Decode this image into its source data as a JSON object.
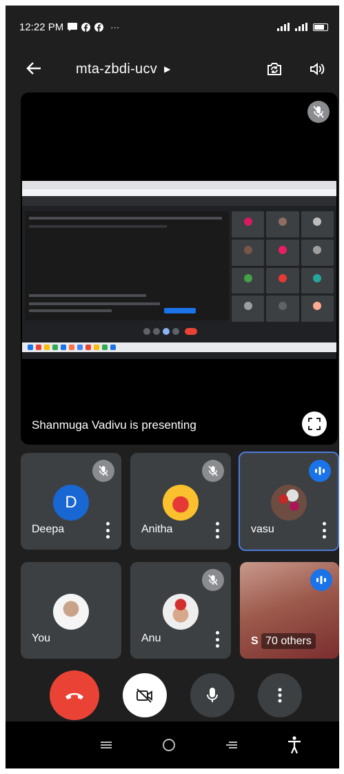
{
  "status_bar": {
    "time": "12:22 PM",
    "notification_icons": [
      "message-icon",
      "facebook-icon",
      "facebook-icon",
      "more-icon"
    ],
    "overflow": "···"
  },
  "app_bar": {
    "meeting_code": "mta-zbdi-ucv",
    "icons": [
      "back-arrow-icon",
      "switch-camera-icon",
      "speaker-icon"
    ]
  },
  "presentation": {
    "label": "Shanmuga Vadivu is presenting"
  },
  "participants": [
    {
      "name": "Deepa",
      "avatar": "D",
      "muted": true,
      "speaking": false
    },
    {
      "name": "Anitha",
      "muted": true,
      "speaking": false
    },
    {
      "name": "vasu",
      "muted": false,
      "speaking": true
    },
    {
      "name": "You",
      "muted": false,
      "speaking": false
    },
    {
      "name": "Anu",
      "muted": true,
      "speaking": false
    }
  ],
  "others_tile": {
    "label": "70 others",
    "prefix": "S"
  },
  "controls": [
    "end-call-icon",
    "camera-off-icon",
    "microphone-icon",
    "more-options-icon"
  ],
  "colors": {
    "background": "#1f1f1f",
    "tile": "#3c4043",
    "end_call": "#ea4335",
    "accent": "#1a73e8"
  }
}
